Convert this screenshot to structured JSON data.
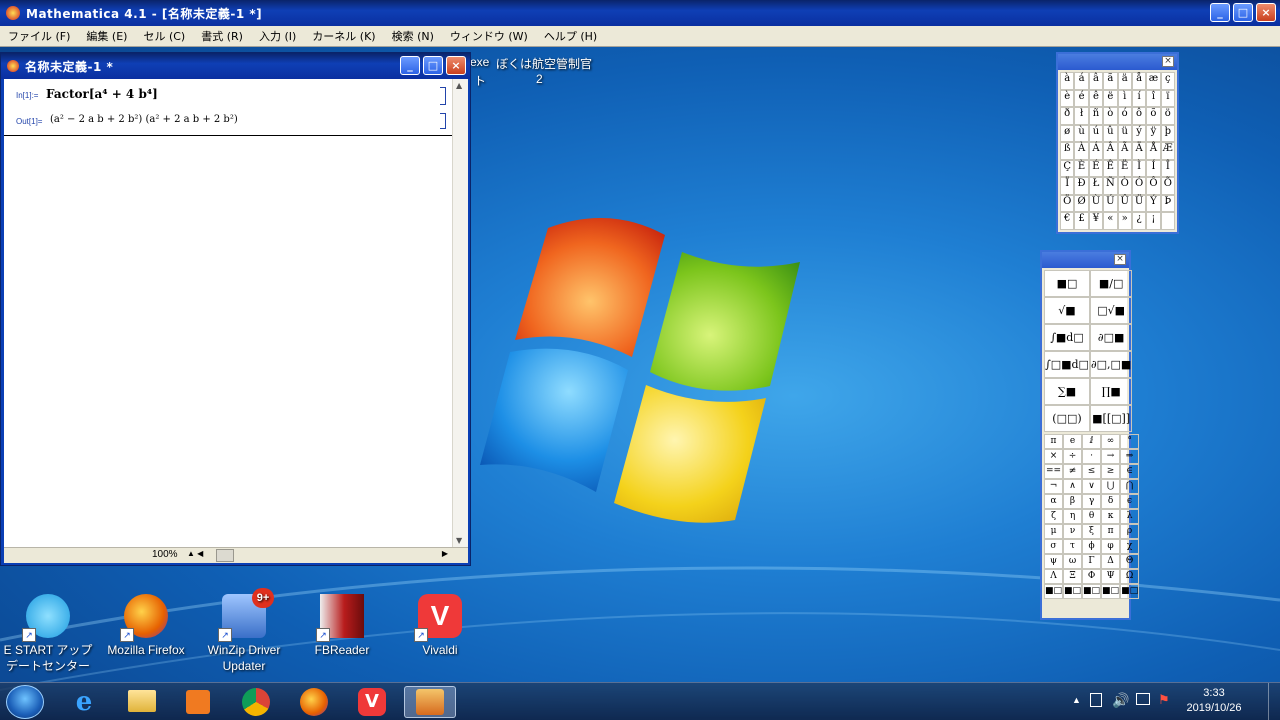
{
  "app": {
    "title": "Mathematica 4.1 - [名称未定義-1 *]",
    "menu": [
      "ファイル (F)",
      "編集 (E)",
      "セル (C)",
      "書式 (R)",
      "入力 (I)",
      "カーネル (K)",
      "検索 (N)",
      "ウィンドウ (W)",
      "ヘルプ (H)"
    ]
  },
  "notebook": {
    "title": "名称未定義-1 *",
    "in_label": "In[1]:=",
    "in_expr": "Factor[a⁴ + 4 b⁴]",
    "out_label": "Out[1]=",
    "out_expr": "(a² − 2 a b + 2 b²) (a² + 2 a b + 2 b²)",
    "zoom": "100%"
  },
  "desktop_text": {
    "exe": "exe",
    "title_frag": "ぼくは航空管制官",
    "num": "2",
    "frag_to": "ト"
  },
  "char_palette": {
    "rows": [
      [
        "à",
        "á",
        "â",
        "ã",
        "ä",
        "å",
        "æ",
        "ç"
      ],
      [
        "è",
        "é",
        "ê",
        "ë",
        "ì",
        "í",
        "î",
        "ï"
      ],
      [
        "ð",
        "ł",
        "ñ",
        "ò",
        "ó",
        "ô",
        "õ",
        "ö"
      ],
      [
        "ø",
        "ù",
        "ú",
        "û",
        "ü",
        "ý",
        "ÿ",
        "þ"
      ],
      [
        "ß",
        "À",
        "Á",
        "Â",
        "Ã",
        "Ä",
        "Å",
        "Æ"
      ],
      [
        "Ç",
        "È",
        "É",
        "Ê",
        "Ë",
        "Ì",
        "Í",
        "Î"
      ],
      [
        "Ï",
        "Ð",
        "Ł",
        "Ñ",
        "Ò",
        "Ó",
        "Ô",
        "Õ"
      ],
      [
        "Ö",
        "Ø",
        "Ù",
        "Ú",
        "Û",
        "Ü",
        "Ý",
        "Þ"
      ],
      [
        "€",
        "£",
        "¥",
        "«",
        "»",
        "¿",
        "¡",
        ""
      ]
    ]
  },
  "math_palette": {
    "templates": [
      "■□",
      "■/□",
      "√■",
      "□√■",
      "∫■d□",
      "∂□■",
      "∫□■d□",
      "∂□,□■",
      "∑■",
      "∏■",
      "(□□)",
      "■[[□]]"
    ],
    "symbols": [
      [
        "π",
        "e",
        "ⅈ",
        "∞",
        "°"
      ],
      [
        "×",
        "÷",
        "·",
        "→",
        "⇒"
      ],
      [
        "==",
        "≠",
        "≤",
        "≥",
        "∈"
      ],
      [
        "¬",
        "∧",
        "∨",
        "⋃",
        "⋂"
      ],
      [
        "α",
        "β",
        "γ",
        "δ",
        "ϵ"
      ],
      [
        "ζ",
        "η",
        "θ",
        "κ",
        "λ"
      ],
      [
        "μ",
        "ν",
        "ξ",
        "π",
        "ρ"
      ],
      [
        "σ",
        "τ",
        "ϕ",
        "φ",
        "χ"
      ],
      [
        "ψ",
        "ω",
        "Γ",
        "Δ",
        "Θ"
      ],
      [
        "Λ",
        "Ξ",
        "Φ",
        "Ψ",
        "Ω"
      ],
      [
        "■□",
        "■□",
        "■□",
        "■□",
        "■□"
      ]
    ]
  },
  "desktop_icons": [
    {
      "label": "E START アップデートセンター",
      "color": "#1b9be0"
    },
    {
      "label": "Mozilla Firefox",
      "color": "#e66000"
    },
    {
      "label": "WinZip Driver Updater",
      "color": "#3a6fc8"
    },
    {
      "label": "FBReader",
      "color": "#b81c1c"
    },
    {
      "label": "Vivaldi",
      "color": "#ef3939"
    }
  ],
  "tray": {
    "time": "3:33",
    "date": "2019/10/26"
  }
}
